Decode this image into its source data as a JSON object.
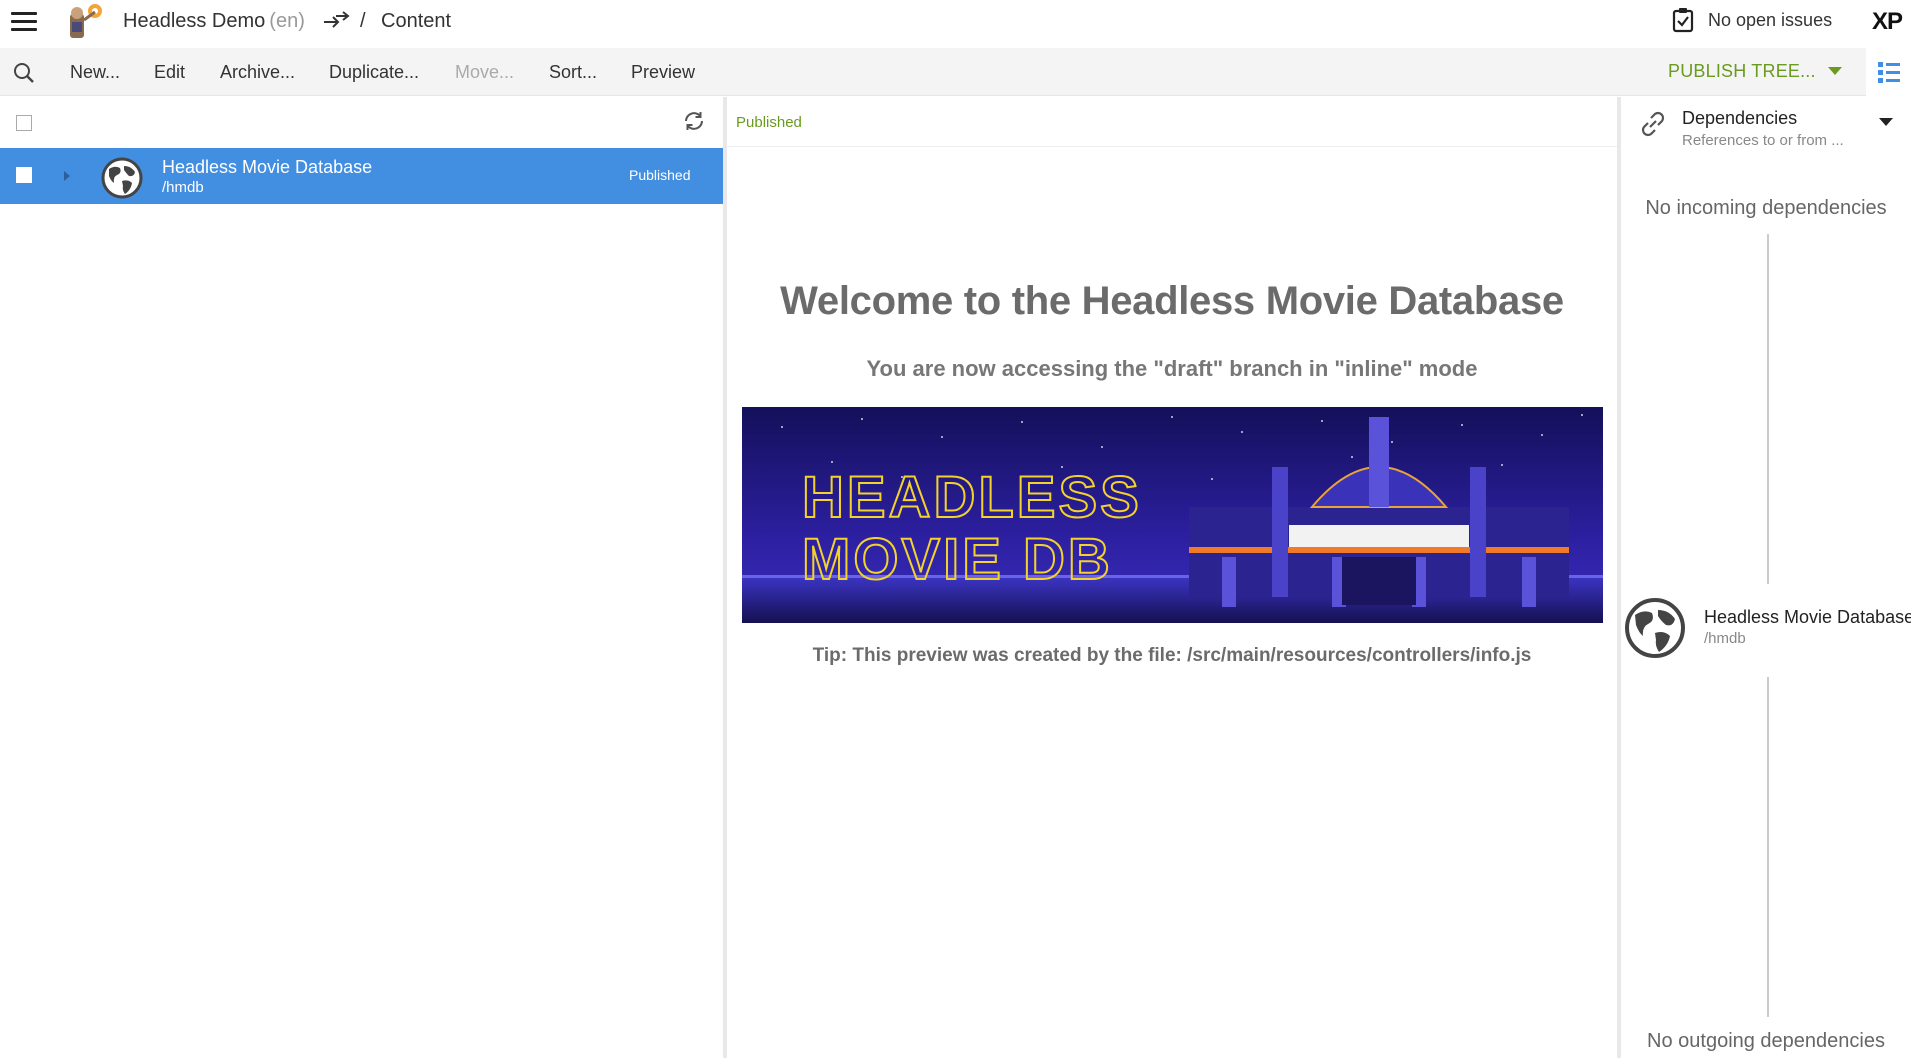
{
  "topbar": {
    "project_name": "Headless Demo",
    "project_lang": "(en)",
    "breadcrumb_sep": "/",
    "breadcrumb_current": "Content",
    "issues_label": "No open issues",
    "xp_logo": "XP"
  },
  "toolbar": {
    "new_label": "New...",
    "edit_label": "Edit",
    "archive_label": "Archive...",
    "duplicate_label": "Duplicate...",
    "move_label": "Move...",
    "sort_label": "Sort...",
    "preview_label": "Preview",
    "publish_label": "PUBLISH TREE...",
    "accent_color": "#6a9a1f"
  },
  "content_tree": {
    "selected_color": "#428ee0",
    "items": [
      {
        "title": "Headless Movie Database",
        "path": "/hmdb",
        "status": "Published",
        "icon": "globe-icon"
      }
    ]
  },
  "preview": {
    "status": "Published",
    "heading": "Welcome to the Headless Movie Database",
    "subheading": "You are now accessing the \"draft\" branch in \"inline\" mode",
    "banner_line1": "HEADLESS",
    "banner_line2": "MOVIE DB",
    "tip": "Tip: This preview was created by the file: /src/main/resources/controllers/info.js"
  },
  "details": {
    "widget_title": "Dependencies",
    "widget_subtitle": "References to or from ...",
    "no_incoming": "No incoming dependencies",
    "node_title": "Headless Movie Database",
    "node_path": "/hmdb",
    "no_outgoing": "No outgoing dependencies"
  }
}
